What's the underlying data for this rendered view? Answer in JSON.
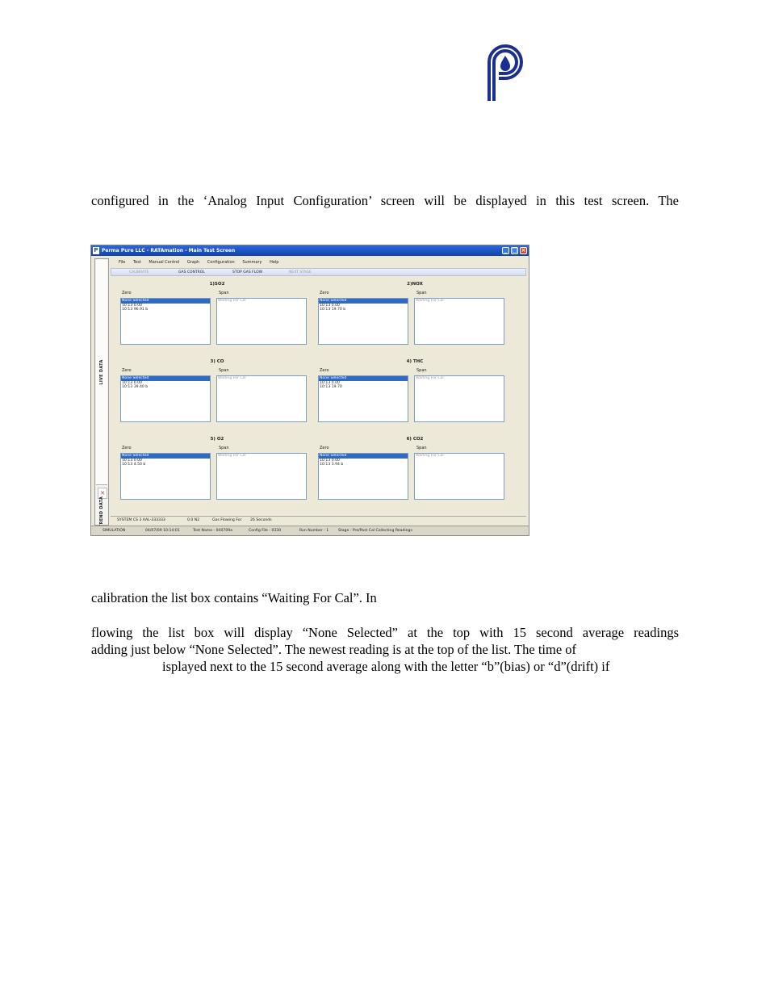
{
  "paragraphs": {
    "p1": "configured in the ‘Analog Input Configuration’ screen will be displayed in this test screen. The",
    "p2": "calibration the list box contains “Waiting For Cal”. In",
    "p3_l1": "flowing the list box will display “None Selected” at the top with 15 second average readings",
    "p3_l2": "adding just below “None Selected”. The newest reading is at the top of the list. The time of",
    "p3_l3": "isplayed next to the 15 second average along with the letter “b”(bias) or “d”(drift)  if"
  },
  "app": {
    "title": "Perma Pure LLC - RATAmation - Main Test Screen",
    "menu": [
      "File",
      "Test",
      "Manual Control",
      "Graph",
      "Configuration",
      "Summary",
      "Help"
    ],
    "toolbar": {
      "btn1": "CALIBRATE",
      "btn2": "GAS CONTROL",
      "btn3": "STOP GAS FLOW",
      "btn4": "NEXT STAGE"
    },
    "sidebar": {
      "live": "LIVE DATA",
      "trend": "TREND DATA"
    },
    "labels": {
      "zero": "Zero",
      "span": "Span"
    },
    "panels": [
      {
        "title": "1)SO2",
        "zero": [
          "None Selected",
          "10:13  0.00",
          "10:13  96.91 b"
        ],
        "span": [
          "Waiting For Cal"
        ]
      },
      {
        "title": "2)NOX",
        "zero": [
          "None Selected",
          "10:13  0.00",
          "10:13  19.70 b"
        ],
        "span": [
          "Waiting For Cal"
        ]
      },
      {
        "title": "3) CO",
        "zero": [
          "None Selected",
          "10:13  0.00",
          "10:13  39.40 b"
        ],
        "span": [
          "Waiting For Cal"
        ]
      },
      {
        "title": "4) THC",
        "zero": [
          "None Selected",
          "10:13  0.00",
          "10:13  19.70"
        ],
        "span": [
          "Waiting For Cal"
        ]
      },
      {
        "title": "5) O2",
        "zero": [
          "None Selected",
          "10:13  0.00",
          "10:13  4.50 b"
        ],
        "span": [
          "Waiting For Cal"
        ]
      },
      {
        "title": "6) CO2",
        "zero": [
          "None Selected",
          "10:13  0.00",
          "10:13  3.94 b"
        ],
        "span": [
          "Waiting For Cal"
        ]
      }
    ],
    "status1": {
      "system": "SYSTEM CS 3  AAL-333333",
      "gas": "0.0  N2",
      "flowing": "Gas Flowing For",
      "seconds": "26 Seconds"
    },
    "status2": {
      "mode": "SIMULATION",
      "datetime": "04/07/09 10:14:01",
      "test": "Test Name - 040709a",
      "config": "Config File - 0330",
      "run": "Run Number - 1",
      "stage": "Stage - Pre/Post Cal Collecting Readings"
    }
  },
  "colors": {
    "logo": "#1b2f8f",
    "titlebar": "#1b50c0",
    "selection": "#316ac5"
  }
}
